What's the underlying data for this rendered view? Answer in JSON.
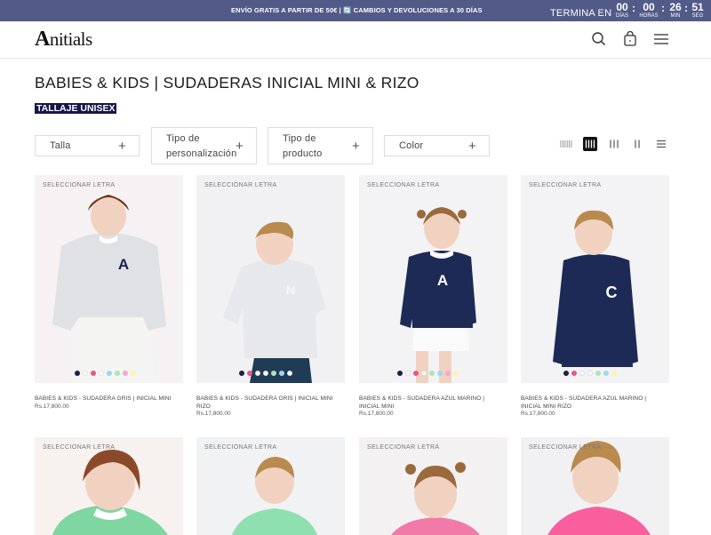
{
  "announcement": {
    "message": "ENVÍO GRATIS A PARTIR DE 50€ | 🔄 CAMBIOS Y DEVOLUCIONES A 30 DÍAS",
    "ends_label": "TERMINA EN",
    "countdown": [
      {
        "value": "00",
        "unit": "DÍAS"
      },
      {
        "value": "00",
        "unit": "HORAS"
      },
      {
        "value": "26",
        "unit": "MIN"
      },
      {
        "value": "51",
        "unit": "SEG"
      }
    ]
  },
  "header": {
    "logo_initial": "A",
    "logo_rest": "nitials"
  },
  "page": {
    "title": "BABIES & KIDS | SUDADERAS INICIAL MINI & RIZO",
    "badge": "TALLAJE UNISEX"
  },
  "filters": [
    {
      "label": "Talla",
      "plus": "+"
    },
    {
      "label": "Tipo de personalización",
      "plus": "+"
    },
    {
      "label": "Tipo de producto",
      "plus": "+"
    },
    {
      "label": "Color",
      "plus": "+"
    }
  ],
  "products": [
    {
      "select_label": "SELECCIONAR LETRA",
      "name": "BABIES & KIDS - SUDADERA GRIS | INICIAL MINI",
      "price": "Rs.17,800.00",
      "letter": "A",
      "swatches": [
        "#1b1f4a",
        "#ffffff",
        "#e05a8a",
        "#ffffff",
        "#9fd8e8",
        "#a8e6b8",
        "#f5a8d0",
        "#fff3a8"
      ]
    },
    {
      "select_label": "SELECCIONAR LETRA",
      "name": "BABIES & KIDS - SUDADERA GRIS | INICIAL MINI RIZO",
      "price": "Rs.17,800.00",
      "letter": "N",
      "swatches": [
        "#1b1f4a",
        "#e05a8a",
        "#ffffff",
        "#ffffff",
        "#a8e6b8",
        "#9fd8e8",
        "#ffffff"
      ]
    },
    {
      "select_label": "SELECCIONAR LETRA",
      "name": "BABIES & KIDS - SUDADERA AZUL MARINO | INICIAL MINI",
      "price": "Rs.17,800.00",
      "letter": "A",
      "swatches": [
        "#1b1f4a",
        "#ffffff",
        "#e05a8a",
        "#ffffff",
        "#a8e6b8",
        "#9fd8e8",
        "#f5a8d0",
        "#fff3a8"
      ]
    },
    {
      "select_label": "SELECCIONAR LETRA",
      "name": "BABIES & KIDS - SUDADERA AZUL MARINO | INICIAL MINI RIZO",
      "price": "Rs.17,800.00",
      "letter": "C",
      "swatches": [
        "#1b1f4a",
        "#e05a8a",
        "#ffffff",
        "#ffffff",
        "#a8e6b8",
        "#9fd8e8",
        "#fff3a8"
      ]
    }
  ],
  "products_row2": [
    {
      "select_label": "SELECCIONAR LETRA"
    },
    {
      "select_label": "SELECCIONAR LETRA"
    },
    {
      "select_label": "SELECCIONAR LETRA"
    },
    {
      "select_label": "SELECCIONAR LETRA"
    }
  ],
  "colors": {
    "announcement_bg": "#525a88",
    "badge_bg": "#15174a",
    "navy": "#1b1f4a",
    "grey_sweater": "#e8e9ec"
  },
  "icons": [
    "search-icon",
    "bag-icon",
    "menu-icon",
    "grid-view-icons"
  ]
}
